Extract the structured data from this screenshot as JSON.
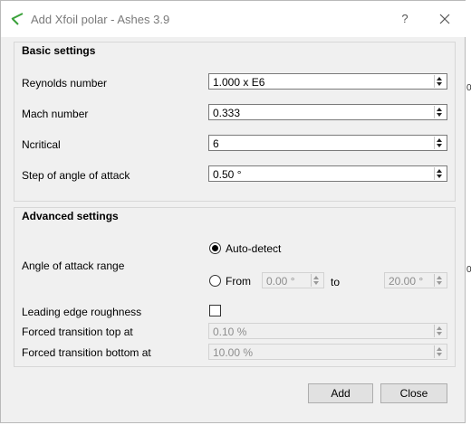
{
  "window": {
    "title": "Add Xfoil polar - Ashes 3.9",
    "help": "?"
  },
  "basic": {
    "title": "Basic settings",
    "reynolds": {
      "label": "Reynolds number",
      "value": "1.000 x E6"
    },
    "mach": {
      "label": "Mach number",
      "value": "0.333"
    },
    "ncritical": {
      "label": "Ncritical",
      "value": "6"
    },
    "step": {
      "label": "Step of angle of attack",
      "value": "0.50 °"
    }
  },
  "advanced": {
    "title": "Advanced settings",
    "aoa_range": {
      "label": "Angle of attack range",
      "auto_label": "Auto-detect",
      "from_label": "From",
      "from_value": "0.00 °",
      "to_label": "to",
      "to_value": "20.00 °",
      "selected": "Auto-detect"
    },
    "roughness": {
      "label": "Leading edge roughness",
      "checked": false
    },
    "transition_top": {
      "label": "Forced transition top at",
      "value": "0.10 %"
    },
    "transition_bottom": {
      "label": "Forced transition bottom at",
      "value": "10.00 %"
    }
  },
  "buttons": {
    "add": "Add",
    "close": "Close"
  },
  "edge_marks": [
    "0",
    "0"
  ]
}
